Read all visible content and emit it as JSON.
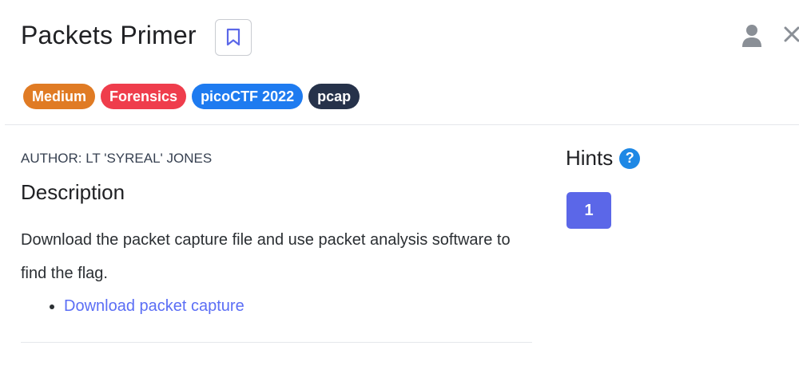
{
  "challenge": {
    "title": "Packets Primer"
  },
  "tags": [
    {
      "label": "Medium",
      "color": "#e07b24"
    },
    {
      "label": "Forensics",
      "color": "#ef3d4c"
    },
    {
      "label": "picoCTF 2022",
      "color": "#1e7bf0"
    },
    {
      "label": "pcap",
      "color": "#26324a"
    }
  ],
  "author": "AUTHOR: LT 'SYREAL' JONES",
  "description": {
    "heading": "Description",
    "text": "Download the packet capture file and use packet analysis software to find the flag.",
    "links": [
      {
        "label": "Download packet capture"
      }
    ]
  },
  "hints": {
    "heading": "Hints",
    "help_symbol": "?",
    "items": [
      {
        "label": "1"
      }
    ]
  },
  "icons": {
    "bookmark": "bookmark-icon",
    "user": "user-icon",
    "close": "close-icon"
  },
  "colors": {
    "accent": "#5b67e8",
    "link": "#5b6ef5",
    "help": "#1e88e5"
  }
}
